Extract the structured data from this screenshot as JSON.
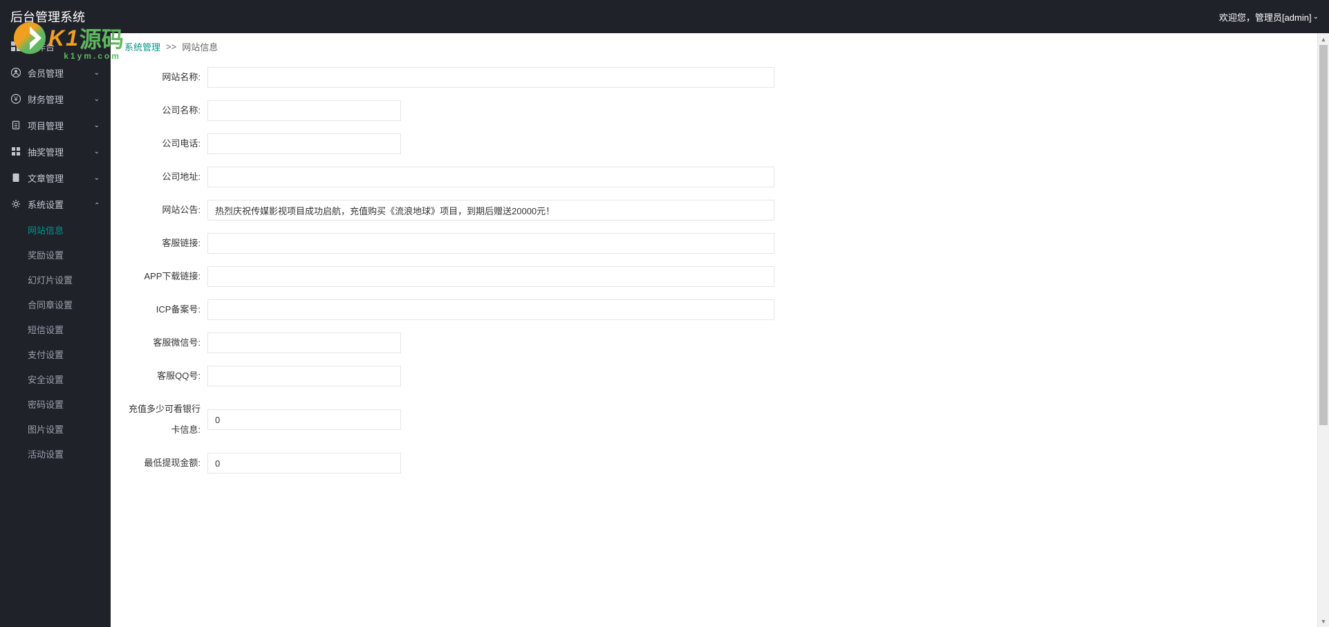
{
  "header": {
    "title": "后台管理系统",
    "welcome": "欢迎您，管理员[admin]"
  },
  "watermark": {
    "brand1": "K1",
    "brand2": "源码",
    "url": "k1ym.com"
  },
  "sidebar": {
    "items": [
      {
        "icon": "grid",
        "label": "工作台",
        "expandable": false
      },
      {
        "icon": "user",
        "label": "会员管理",
        "expandable": true,
        "open": false
      },
      {
        "icon": "money",
        "label": "财务管理",
        "expandable": true,
        "open": false
      },
      {
        "icon": "clipboard",
        "label": "项目管理",
        "expandable": true,
        "open": false
      },
      {
        "icon": "lottery",
        "label": "抽奖管理",
        "expandable": true,
        "open": false
      },
      {
        "icon": "doc",
        "label": "文章管理",
        "expandable": true,
        "open": false
      },
      {
        "icon": "gear",
        "label": "系统设置",
        "expandable": true,
        "open": true
      }
    ],
    "subItems": [
      {
        "label": "网站信息",
        "active": true
      },
      {
        "label": "奖励设置",
        "active": false
      },
      {
        "label": "幻灯片设置",
        "active": false
      },
      {
        "label": "合同章设置",
        "active": false
      },
      {
        "label": "短信设置",
        "active": false
      },
      {
        "label": "支付设置",
        "active": false
      },
      {
        "label": "安全设置",
        "active": false
      },
      {
        "label": "密码设置",
        "active": false
      },
      {
        "label": "图片设置",
        "active": false
      },
      {
        "label": "活动设置",
        "active": false
      }
    ]
  },
  "breadcrumb": {
    "link": "系统管理",
    "sep": ">>",
    "current": "网站信息"
  },
  "form": {
    "fields": [
      {
        "label": "网站名称:",
        "width": "wide",
        "value": ""
      },
      {
        "label": "公司名称:",
        "width": "narrow",
        "value": ""
      },
      {
        "label": "公司电话:",
        "width": "narrow",
        "value": ""
      },
      {
        "label": "公司地址:",
        "width": "wide",
        "value": ""
      },
      {
        "label": "网站公告:",
        "width": "wide",
        "value": "热烈庆祝传媒影视项目成功启航，充值购买《流浪地球》项目，到期后赠送20000元！"
      },
      {
        "label": "客服链接:",
        "width": "wide",
        "value": ""
      },
      {
        "label": "APP下载链接:",
        "width": "wide",
        "value": ""
      },
      {
        "label": "ICP备案号:",
        "width": "wide",
        "value": ""
      },
      {
        "label": "客服微信号:",
        "width": "narrow",
        "value": ""
      },
      {
        "label": "客服QQ号:",
        "width": "narrow",
        "value": ""
      },
      {
        "label": "充值多少可看银行卡信息:",
        "width": "narrow",
        "value": "0"
      },
      {
        "label": "最低提现金额:",
        "width": "narrow",
        "value": "0"
      }
    ]
  }
}
